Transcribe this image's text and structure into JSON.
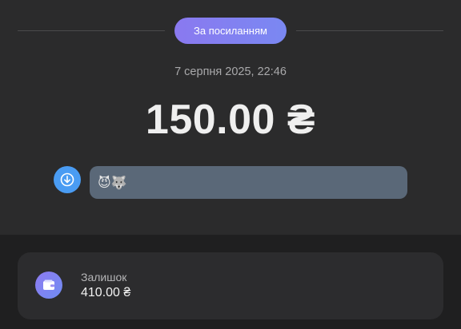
{
  "header": {
    "type_label": "За посиланням"
  },
  "transaction": {
    "date": "7 серпня 2025, 22:46",
    "amount": "150.00 ₴",
    "comment": "😈🐺",
    "direction_icon": "arrow-down-circle-icon"
  },
  "balance": {
    "label": "Залишок",
    "value": "410.00 ₴",
    "icon": "wallet-icon"
  },
  "colors": {
    "accent_gradient_start": "#8a79f0",
    "accent_gradient_end": "#7a88f2",
    "incoming_blue": "#4a9cf3",
    "comment_bg": "#5a6878"
  }
}
